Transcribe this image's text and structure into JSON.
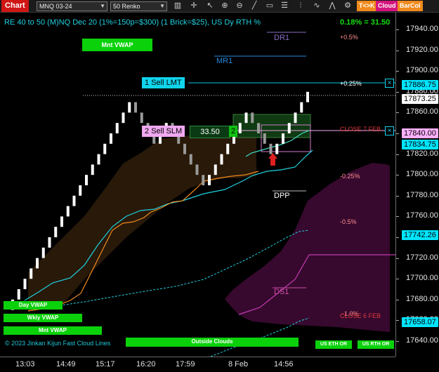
{
  "toolbar": {
    "window_title": "Chart",
    "instrument": "MNQ 03-24",
    "bar_type": "50 Renko",
    "buttons": {
      "tk": "T<>K",
      "cloud": "Cloud",
      "barcol": "BarCol"
    },
    "colors": {
      "tk": "#f08a1c",
      "cloud": "#d4147e",
      "barcol": "#f08a1c"
    },
    "icons": [
      "dropdown-arrow-icon",
      "dropdown-arrow-icon",
      "bar-type-icon",
      "crosshair-icon",
      "zoom-in-icon",
      "zoom-out-icon",
      "cursor-icon",
      "draw-line-icon",
      "data-box-icon",
      "properties-icon",
      "indicators-icon",
      "strategy-icon",
      "trade-icon"
    ]
  },
  "chart": {
    "header": "RE 40 to 50 (M)NQ Dec 20 (1%=150p=$300) (1 Brick=$25), US Dy RTH %",
    "change": "0.18% = 31.50",
    "ylim": [
      17620,
      17950
    ],
    "y_ticks": [
      17640,
      17660,
      17680,
      17700,
      17720,
      17740,
      17760,
      17780,
      17800,
      17820,
      17840,
      17860,
      17880,
      17900,
      17920,
      17940
    ],
    "x_labels": [
      "13:03",
      "14:49",
      "15:17",
      "16:20",
      "17:59",
      "8 Feb",
      "14:56"
    ],
    "levels": [
      {
        "name": "DR1",
        "price": 17932,
        "color": "#8a6cc8"
      },
      {
        "name": "MR1",
        "price": 17911,
        "color": "#2a8ae0"
      },
      {
        "name": "DPP",
        "price": 17781,
        "color": "#ffffff"
      },
      {
        "name": "DS1",
        "price": 17691,
        "color": "#cc4ca8"
      }
    ],
    "percent_labels": [
      {
        "text": "+0.5%",
        "price": 17930,
        "color": "#ff9090"
      },
      {
        "text": "+0.25%",
        "price": 17885,
        "color": "#ffffff"
      },
      {
        "text": "-0.25%",
        "price": 17797,
        "color": "#ff9090"
      },
      {
        "text": "-0.5%",
        "price": 17753,
        "color": "#ff9090"
      },
      {
        "text": "-1.0%",
        "price": 17665,
        "color": "#ff9090"
      }
    ],
    "close_labels": [
      {
        "text": "CLOSE 7 FEB",
        "price": 17841,
        "color": "#e03a3a"
      },
      {
        "text": "CLOSE 6 FEB",
        "price": 17661,
        "color": "#e03a3a"
      }
    ],
    "orders": {
      "sell_lmt": {
        "qty": "1",
        "label": "Sell LMT",
        "price": 17886.75
      },
      "sell_slm": {
        "qty": "2",
        "label": "Sell SLM",
        "price": 17840.0
      },
      "position": {
        "pnl": "33.50",
        "qty": "2"
      }
    },
    "price_markers": [
      {
        "price": "17886.75",
        "color": "#00e5ff"
      },
      {
        "price": "17873.25",
        "color": "#ffffff"
      },
      {
        "price": "17840.00",
        "color": "#ffb0ff"
      },
      {
        "price": "17834.75",
        "color": "#00e5ff"
      },
      {
        "price": "17742.26",
        "color": "#00e5ff"
      },
      {
        "price": "17658.07",
        "color": "#00e5ff"
      }
    ],
    "vwap_buttons": {
      "mnt_vwap_top": "Mnt VWAP",
      "day_vwap": "Day VWAP",
      "wkly_vwap": "Wkly VWAP",
      "mnt_vwap": "Mnt VWAP"
    },
    "bottom_buttons": {
      "outside_clouds": "Outside Clouds",
      "us_eth_or": "US ETH OR",
      "us_rth_or": "US RTH OR"
    },
    "copyright": "© 2023 Jinkan Kijun Fast Cloud Lines",
    "renko": {
      "bricks": [
        17680,
        17690,
        17700,
        17710,
        17720,
        17730,
        17740,
        17750,
        17760,
        17770,
        17780,
        17790,
        17800,
        17810,
        17820,
        17830,
        17840,
        17850,
        17860,
        17870,
        17860,
        17850,
        17840,
        17830,
        17840,
        17850,
        17840,
        17830,
        17820,
        17810,
        17800,
        17790,
        17800,
        17810,
        17820,
        17830,
        17840,
        17850,
        17860,
        17850,
        17840,
        17830,
        17820,
        17830,
        17840,
        17850,
        17860,
        17870,
        17880
      ]
    }
  }
}
